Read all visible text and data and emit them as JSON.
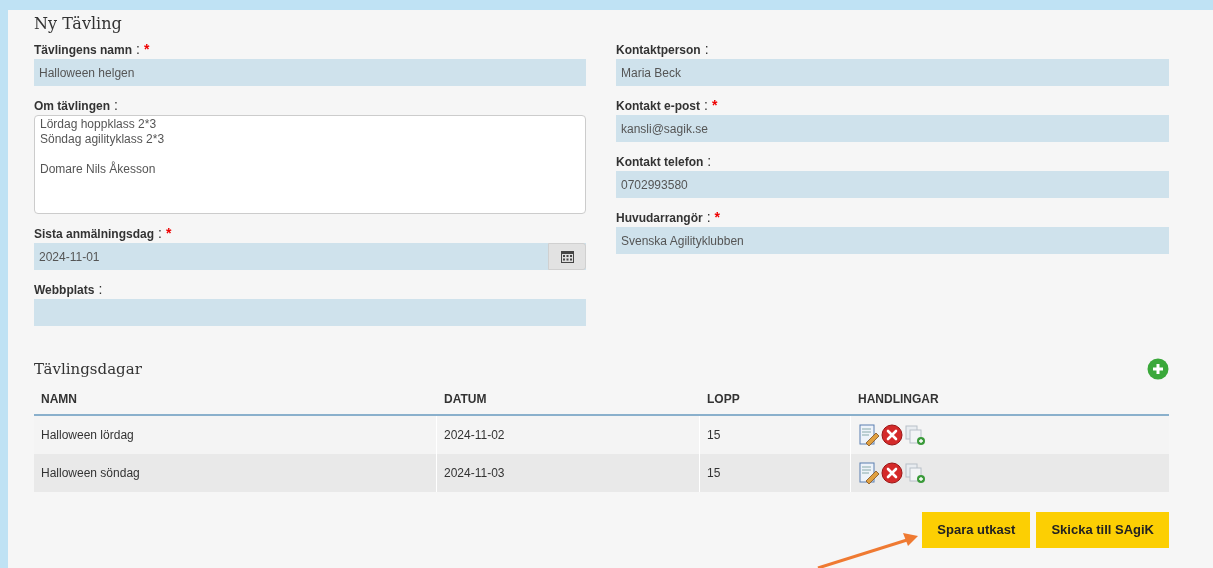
{
  "title": "Ny Tävling",
  "left_fields": [
    {
      "kind": "input",
      "label": "Tävlingens namn",
      "required": true,
      "value": "Halloween helgen"
    },
    {
      "kind": "textarea",
      "label": "Om tävlingen",
      "required": false,
      "value": "Lördag hoppklass 2*3\nSöndag agilityklass 2*3\n\nDomare Nils Åkesson"
    },
    {
      "kind": "date",
      "label": "Sista anmälningsdag",
      "required": true,
      "value": "2024-11-01"
    },
    {
      "kind": "input",
      "label": "Webbplats",
      "required": false
    }
  ],
  "right_fields": [
    {
      "kind": "input",
      "label": "Kontaktperson",
      "required": false,
      "value": "Maria Beck"
    },
    {
      "kind": "input",
      "label": "Kontakt e-post",
      "required": true,
      "value": "kansli@sagik.se"
    },
    {
      "kind": "input",
      "label": "Kontakt telefon",
      "required": false,
      "value": "0702993580"
    },
    {
      "kind": "input",
      "label": "Huvudarrangör",
      "required": true,
      "value": "Svenska Agilityklubben"
    }
  ],
  "label_separator": ":",
  "required_mark": "*",
  "days": {
    "title": "Tävlingsdagar",
    "columns": [
      "NAMN",
      "DATUM",
      "LOPP",
      "HANDLINGAR"
    ],
    "rows": [
      {
        "name": "Halloween lördag",
        "date": "2024-11-02",
        "runs": "15"
      },
      {
        "name": "Halloween söndag",
        "date": "2024-11-03",
        "runs": "15"
      }
    ]
  },
  "buttons": [
    "Spara utkast",
    "Skicka till SAgiK"
  ]
}
